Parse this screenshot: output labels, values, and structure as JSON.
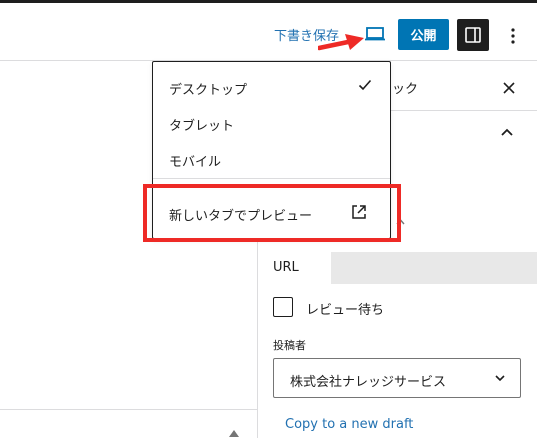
{
  "toolbar": {
    "save_draft_label": "下書き保存",
    "publish_label": "公開",
    "preview_icon": "desktop-icon",
    "settings_icon": "sidebar-toggle-icon",
    "more_icon": "more-vertical-icon"
  },
  "preview_menu": {
    "items": [
      {
        "label": "デスクトップ",
        "checked": true
      },
      {
        "label": "タブレット",
        "checked": false
      },
      {
        "label": "モバイル",
        "checked": false
      }
    ],
    "new_tab_label": "新しいタブでプレビュー",
    "new_tab_icon": "external-link-icon"
  },
  "sidebar": {
    "tab_fragment": "ック",
    "url_label": "URL",
    "url_value": "",
    "pending_review_label": "レビュー待ち",
    "pending_review_checked": false,
    "author_label": "投稿者",
    "author_value": "株式会社ナレッジサービス",
    "copy_draft_label": "Copy to a new draft"
  },
  "colors": {
    "accent": "#0075b4",
    "link": "#2271b1",
    "annotation": "#ee2a26",
    "dark": "#1e1e1e"
  }
}
